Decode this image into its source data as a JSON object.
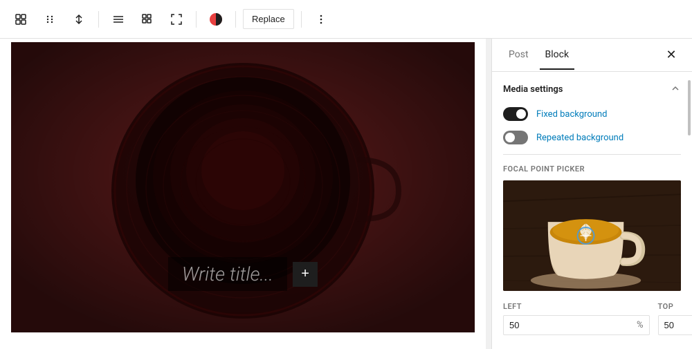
{
  "toolbar": {
    "replace_label": "Replace",
    "buttons": [
      {
        "id": "block-nav",
        "icon": "⊞",
        "label": "block-nav-icon"
      },
      {
        "id": "drag",
        "icon": "⠿",
        "label": "drag-icon"
      },
      {
        "id": "move-up-down",
        "icon": "⇅",
        "label": "move-icon"
      },
      {
        "id": "align",
        "icon": "≡",
        "label": "align-icon"
      },
      {
        "id": "grid",
        "icon": "⊞",
        "label": "grid-icon"
      },
      {
        "id": "fullscreen",
        "icon": "⛶",
        "label": "fullscreen-icon"
      },
      {
        "id": "options",
        "icon": "⋮",
        "label": "more-options-icon"
      }
    ]
  },
  "canvas": {
    "write_title_placeholder": "Write title..."
  },
  "panel": {
    "tab_post": "Post",
    "tab_block": "Block",
    "active_tab": "Block",
    "close_label": "✕",
    "media_settings_label": "Media settings",
    "fixed_background_label": "Fixed background",
    "repeated_background_label": "Repeated background",
    "fixed_background_enabled": true,
    "repeated_background_enabled": false,
    "focal_point_label": "FOCAL POINT PICKER",
    "left_label": "LEFT",
    "top_label": "TOP",
    "left_value": "50",
    "top_value": "50",
    "percent_symbol": "%"
  }
}
